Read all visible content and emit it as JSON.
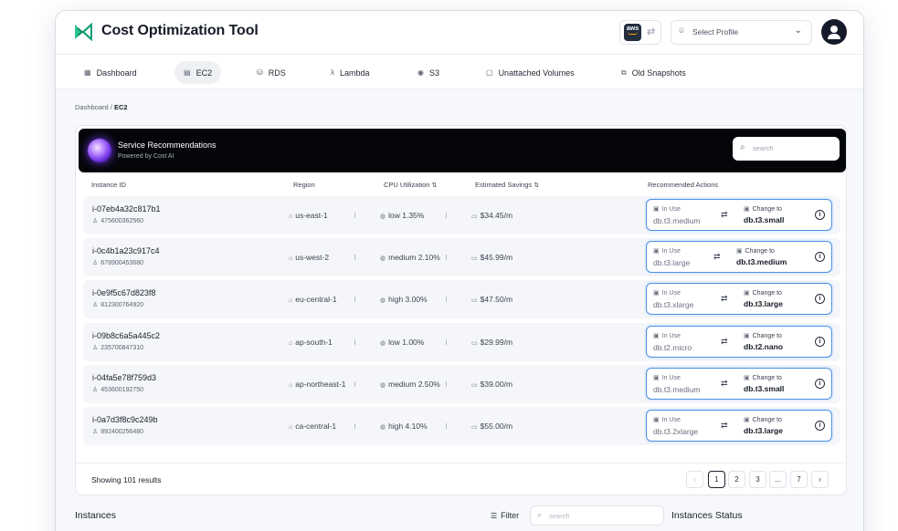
{
  "app": {
    "title": "Cost Optimization Tool"
  },
  "header": {
    "aws_label": "aws",
    "profile_placeholder": "Select Profile"
  },
  "nav": [
    {
      "label": "Dashboard",
      "icon": "dashboard-icon",
      "active": false
    },
    {
      "label": "EC2",
      "icon": "server-icon",
      "active": true
    },
    {
      "label": "RDS",
      "icon": "database-icon",
      "active": false
    },
    {
      "label": "Lambda",
      "icon": "lambda-icon",
      "active": false
    },
    {
      "label": "S3",
      "icon": "bucket-icon",
      "active": false
    },
    {
      "label": "Unattached Volumes",
      "icon": "volume-icon",
      "active": false
    },
    {
      "label": "Old Snapshots",
      "icon": "snapshot-icon",
      "active": false
    }
  ],
  "breadcrumb": {
    "parent": "Dashboard /",
    "current": "EC2"
  },
  "recommendations": {
    "title": "Service Recommendations",
    "subtitle": "Powered by Cost AI",
    "search_placeholder": "search",
    "columns": {
      "instance_id": "Instance ID",
      "region": "Region",
      "cpu": "CPU Utilization",
      "savings": "Estimated Savings",
      "actions": "Recommended Actions"
    },
    "rows": [
      {
        "id": "i-07eb4a32c817b1",
        "account": "475600362560",
        "region": "us-east-1",
        "cpu": "low 1.35%",
        "savings": "$34.45/m",
        "in_use_label": "In Use",
        "from": "db.t3.medium",
        "change_label": "Change to",
        "to": "db.t3.small"
      },
      {
        "id": "i-0c4b1a23c917c4",
        "account": "678900453680",
        "region": "us-west-2",
        "cpu": "medium 2.10%",
        "savings": "$45.99/m",
        "in_use_label": "In Use",
        "from": "db.t3.large",
        "change_label": "Change to",
        "to": "db.t3.medium"
      },
      {
        "id": "i-0e9f5c67d823f8",
        "account": "812300764920",
        "region": "eu-central-1",
        "cpu": "high 3.00%",
        "savings": "$47.50/m",
        "in_use_label": "In Use",
        "from": "db.t3.xlarge",
        "change_label": "Change to",
        "to": "db.t3.large"
      },
      {
        "id": "i-09b8c6a5a445c2",
        "account": "235700847310",
        "region": "ap-south-1",
        "cpu": "low 1.00%",
        "savings": "$29.99/m",
        "in_use_label": "In Use",
        "from": "db.t2.micro",
        "change_label": "Change to",
        "to": "db.t2.nano"
      },
      {
        "id": "i-04fa5e78f759d3",
        "account": "453600192750",
        "region": "ap-northeast-1",
        "cpu": "medium 2.50%",
        "savings": "$39.00/m",
        "in_use_label": "In Use",
        "from": "db.t3.medium",
        "change_label": "Change to",
        "to": "db.t3.small"
      },
      {
        "id": "i-0a7d3f8c9c249b",
        "account": "892400256480",
        "region": "ca-central-1",
        "cpu": "high 4.10%",
        "savings": "$55.00/m",
        "in_use_label": "In Use",
        "from": "db.t3.2xlarge",
        "change_label": "Change to",
        "to": "db.t3.large"
      }
    ],
    "showing": "Showing 101 results",
    "pagination": {
      "prev": "‹",
      "pages": [
        "1",
        "2",
        "3",
        "...",
        "7"
      ],
      "current": "1",
      "next": "›"
    }
  },
  "instances": {
    "title": "Instances",
    "filter_label": "Filter",
    "search_placeholder": "search",
    "status_title": "Instances Status"
  }
}
